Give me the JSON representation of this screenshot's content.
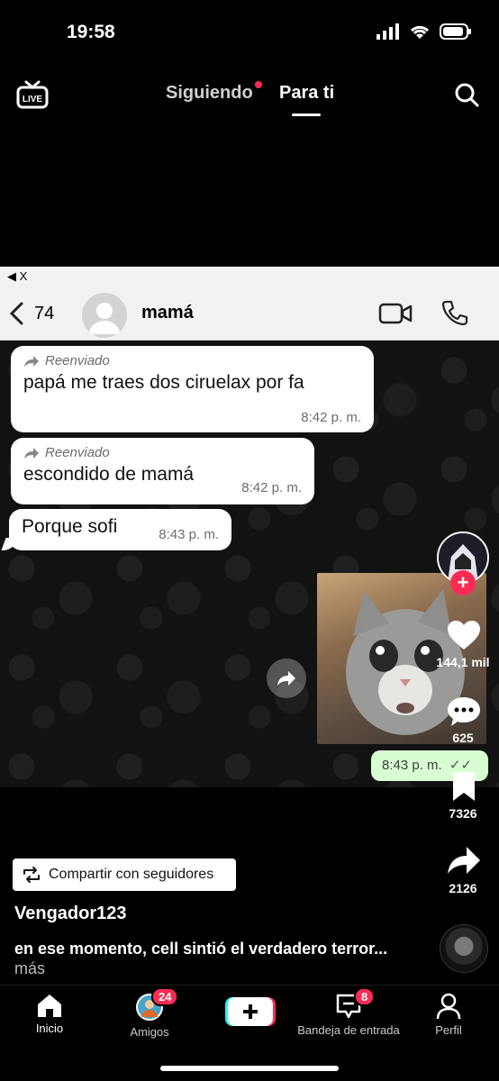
{
  "status_bar": {
    "time": "19:58"
  },
  "top_nav": {
    "live_label": "LIVE",
    "tabs": [
      {
        "label": "Siguiendo"
      },
      {
        "label": "Para ti"
      }
    ]
  },
  "video": {
    "ios_back": "◀ X",
    "chat": {
      "back_count": "74",
      "contact_name": "mamá",
      "messages": [
        {
          "forwarded": "Reenviado",
          "text": "papá me traes dos ciruelax por fa",
          "time": "8:42 p. m."
        },
        {
          "forwarded": "Reenviado",
          "text": "escondido de mamá",
          "time": "8:42 p. m."
        },
        {
          "forwarded": "",
          "text": "Porque sofi",
          "time": "8:43 p. m."
        }
      ],
      "sent": {
        "time": "8:43 p. m.",
        "ticks": "✓✓"
      }
    }
  },
  "actions": {
    "likes": "144,1 mil",
    "comments": "625",
    "saves": "7326",
    "shares": "2126"
  },
  "caption": {
    "share_button": "Compartir con seguidores",
    "username": "Vengador123",
    "text": "en ese momento, cell sintió el verdadero terror...",
    "more": "más"
  },
  "bottom_nav": {
    "items": [
      {
        "label": "Inicio"
      },
      {
        "label": "Amigos",
        "badge": "24"
      },
      {
        "label": "Bandeja de entrada",
        "badge": "8"
      },
      {
        "label": "Perfil"
      }
    ]
  },
  "colors": {
    "accent": "#fe2c55",
    "sent_bubble": "#d9fdd3"
  }
}
